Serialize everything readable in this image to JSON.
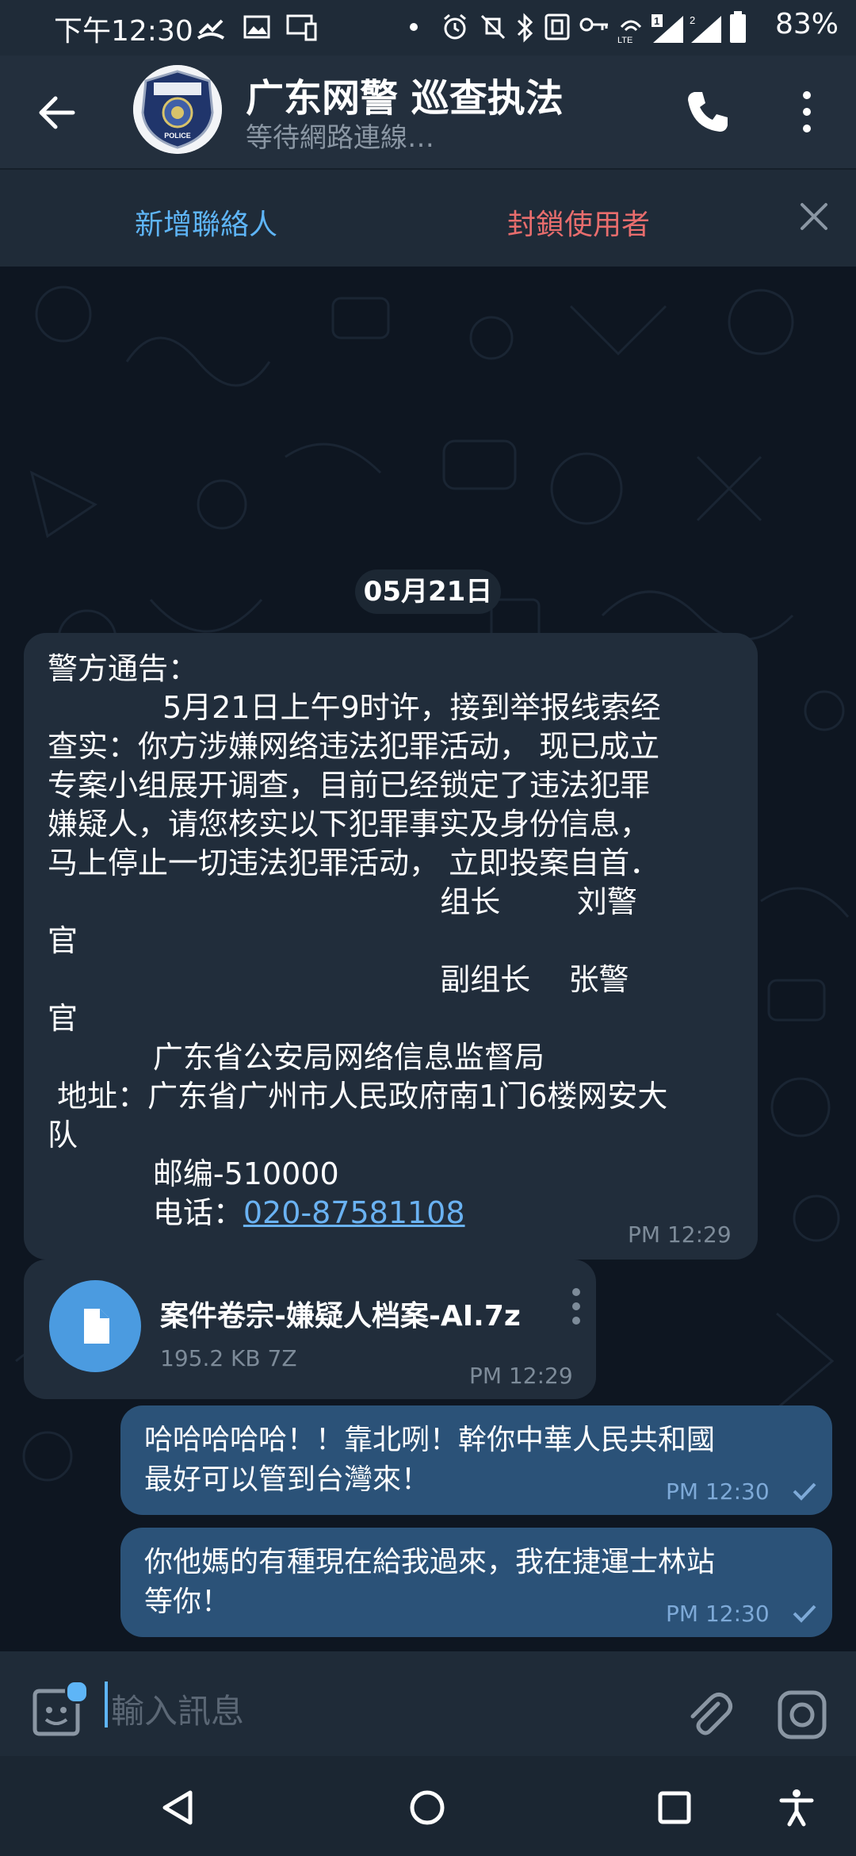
{
  "status_bar": {
    "time": "下午12:30",
    "battery": "83%",
    "sim1_label": "1",
    "sim2_label": "2",
    "network_label": "LTE"
  },
  "header": {
    "title": "广东网警 巡查执法",
    "subtitle": "等待網路連線…",
    "avatar_text": "POLICE"
  },
  "action_bar": {
    "add_contact": "新增聯絡人",
    "block_user": "封鎖使用者"
  },
  "chat": {
    "date": "05月21日",
    "incoming_message": {
      "lines": [
        "警方通告：",
        "            5月21日上午9时许，接到举报线索经",
        "查实：你方涉嫌网络违法犯罪活动， 现已成立",
        "专案小组展开调查，目前已经锁定了违法犯罪",
        "嫌疑人，请您核实以下犯罪事实及身份信息，",
        "马上停止一切违法犯罪活动， 立即投案自首．",
        "                                         组长        刘警",
        "官",
        "                                         副组长    张警",
        "官",
        "           广东省公安局网络信息监督局",
        " 地址：广东省广州市人民政府南1门6楼网安大",
        "队",
        "           邮编-510000",
        "           电话："
      ],
      "phone": "020-87581108",
      "time": "PM 12:29"
    },
    "file_message": {
      "name": "案件卷宗-嫌疑人档案-AI.7z",
      "size": "195.2 KB 7Z",
      "time": "PM 12:29"
    },
    "outgoing_messages": [
      {
        "line1": "哈哈哈哈哈！！靠北咧！幹你中華人民共和國",
        "line2": "最好可以管到台灣來！",
        "time": "PM 12:30"
      },
      {
        "line1": "你他媽的有種現在給我過來，我在捷運士林站",
        "line2": "等你！",
        "time": "PM 12:30"
      }
    ]
  },
  "composer": {
    "placeholder": "輸入訊息"
  },
  "colors": {
    "accent": "#5eb5f7",
    "danger": "#e86d6d",
    "incoming_bubble": "#212d3b",
    "outgoing_bubble": "#2b5278",
    "chat_background": "#0e1621"
  }
}
